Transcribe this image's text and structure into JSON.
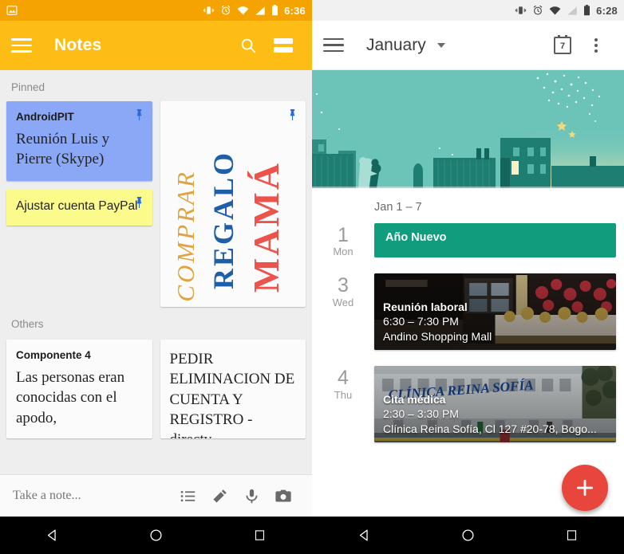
{
  "notes_app": {
    "statusbar": {
      "time": "6:36",
      "icons": [
        "photo-icon",
        "vibrate-icon",
        "alarm-icon",
        "wifi-icon",
        "signal-icon",
        "battery-icon"
      ],
      "bg_color": "#f5a300"
    },
    "toolbar": {
      "title": "Notes",
      "menu_icon": "hamburger-icon",
      "search_icon": "search-icon",
      "view_toggle_icon": "list-view-icon",
      "bg_color": "#fdbd15"
    },
    "sections": [
      {
        "label": "Pinned",
        "notes": [
          {
            "title": "AndroidPIT",
            "text": "Reunión Luis y Pierre (Skype)",
            "color": "#8aa8f5",
            "pinned": true
          },
          {
            "title": "",
            "text": "Ajustar cuenta PayPal",
            "color": "#fbfb8b",
            "pinned": true
          },
          {
            "title": "",
            "text": "COMPRAR REGALO MAMÁ",
            "color": "#fbfbfb",
            "pinned": true,
            "handwriting": [
              {
                "word": "COMPRAR",
                "color": "#e0a33e"
              },
              {
                "word": "REGALO",
                "color": "#1e5fa8"
              },
              {
                "word": "MAMÁ",
                "color": "#ec534b"
              }
            ]
          }
        ]
      },
      {
        "label": "Others",
        "notes": [
          {
            "title": "Componente 4",
            "text": "Las personas eran conocidas con el apodo,",
            "color": "#fbfbfb",
            "pinned": false
          },
          {
            "title": "",
            "text": "PEDIR ELIMINACION DE CUENTA Y REGISTRO - directv",
            "color": "#fbfbfb",
            "pinned": false
          }
        ]
      }
    ],
    "compose_bar": {
      "placeholder": "Take a note...",
      "actions": [
        "list-icon",
        "brush-icon",
        "microphone-icon",
        "camera-icon"
      ]
    },
    "navbar": {
      "buttons": [
        "back-icon",
        "home-icon",
        "recents-icon"
      ]
    }
  },
  "calendar_app": {
    "statusbar": {
      "time": "6:28",
      "icons": [
        "vibrate-icon",
        "alarm-icon",
        "wifi-icon",
        "signal-icon",
        "battery-icon"
      ],
      "bg_color": "#f1f1f1"
    },
    "toolbar": {
      "month": "January",
      "menu_icon": "hamburger-icon",
      "dropdown_icon": "chevron-down-icon",
      "today_icon": "calendar-today-icon",
      "today_number": "7",
      "overflow_icon": "overflow-menu-icon"
    },
    "hero": {
      "illustration": "city-skyline-night-illustration",
      "bg_color": "#6cc4b8"
    },
    "range_label": "Jan 1 – 7",
    "days": [
      {
        "number": "1",
        "weekday": "Mon",
        "events": [
          {
            "type": "chip",
            "title": "Año Nuevo",
            "color": "#0f9d7e"
          }
        ]
      },
      {
        "number": "3",
        "weekday": "Wed",
        "events": [
          {
            "type": "photo",
            "title": "Reunión laboral",
            "time": "6:30 – 7:30 PM",
            "place": "Andino Shopping Mall",
            "photo": "shopping-mall-photo"
          }
        ]
      },
      {
        "number": "4",
        "weekday": "Thu",
        "events": [
          {
            "type": "photo",
            "title": "Cita médica",
            "time": "2:30 – 3:30 PM",
            "place": "Clínica Reina Sofía, Cl 127 #20-78, Bogo...",
            "photo": "clinica-reina-sofia-photo"
          }
        ]
      }
    ],
    "fab": {
      "icon": "plus-icon",
      "color": "#e8453c"
    },
    "navbar": {
      "buttons": [
        "back-icon",
        "home-icon",
        "recents-icon"
      ]
    }
  }
}
